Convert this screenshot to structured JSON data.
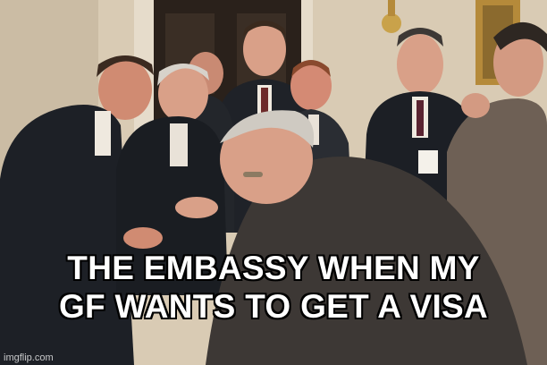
{
  "meme": {
    "caption_line1": "THE EMBASSY WHEN MY",
    "caption_line2": "GF WANTS TO GET A VISA",
    "watermark": "imgflip.com"
  },
  "colors": {
    "wall": "#d9cbb4",
    "door": "#2a211b",
    "suit": "#1f2228",
    "skin": "#d9a088",
    "hair_gray": "#c9c3ba",
    "caption_text": "#ffffff",
    "caption_outline": "#000000"
  }
}
